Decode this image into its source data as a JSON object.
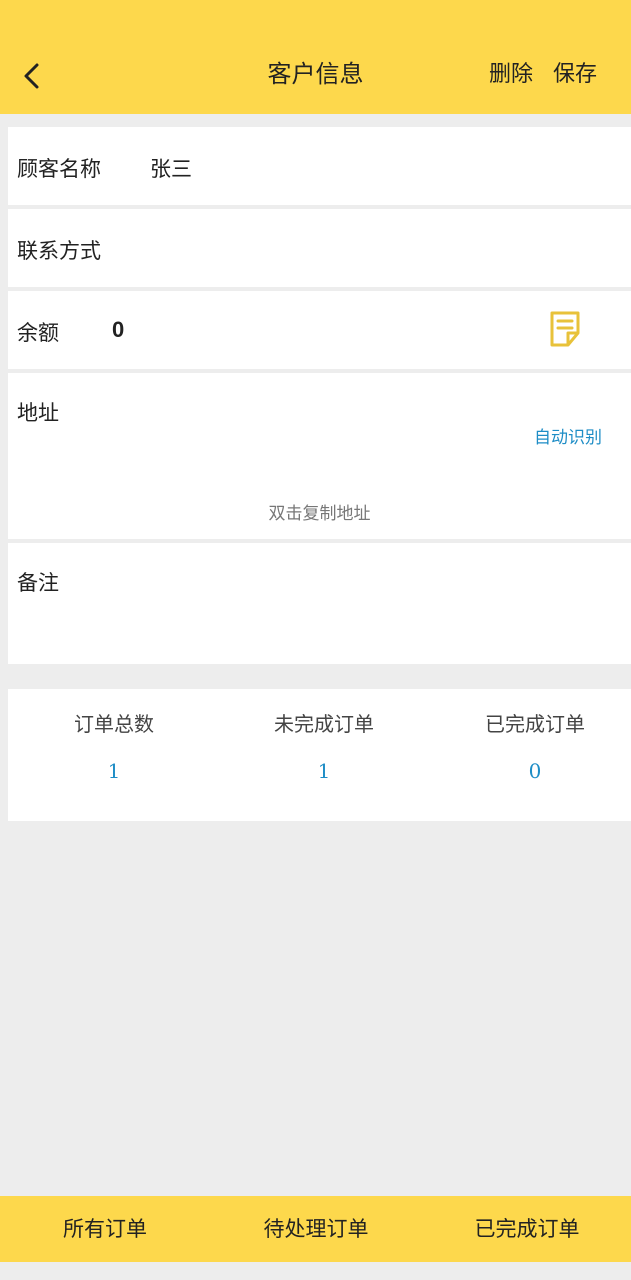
{
  "header": {
    "title": "客户信息",
    "back_icon": "chevron-left-icon",
    "delete_label": "删除",
    "save_label": "保存",
    "background": "#fdd84c"
  },
  "form": {
    "name_label": "顾客名称",
    "name_value": "张三",
    "contact_label": "联系方式",
    "contact_value": "",
    "balance_label": "余额",
    "balance_value": "0",
    "balance_icon": "note-edit-icon",
    "address_label": "地址",
    "auto_detect_label": "自动识别",
    "copy_address_hint": "双击复制地址",
    "note_label": "备注"
  },
  "stats": [
    {
      "label": "订单总数",
      "value": "1"
    },
    {
      "label": "未完成订单",
      "value": "1"
    },
    {
      "label": "已完成订单",
      "value": "0"
    }
  ],
  "bottom_tabs": [
    {
      "label": "所有订单"
    },
    {
      "label": "待处理订单"
    },
    {
      "label": "已完成订单"
    }
  ],
  "colors": {
    "accent": "#fdd84c",
    "link": "#1e8dc6",
    "icon": "#e8c23a"
  }
}
